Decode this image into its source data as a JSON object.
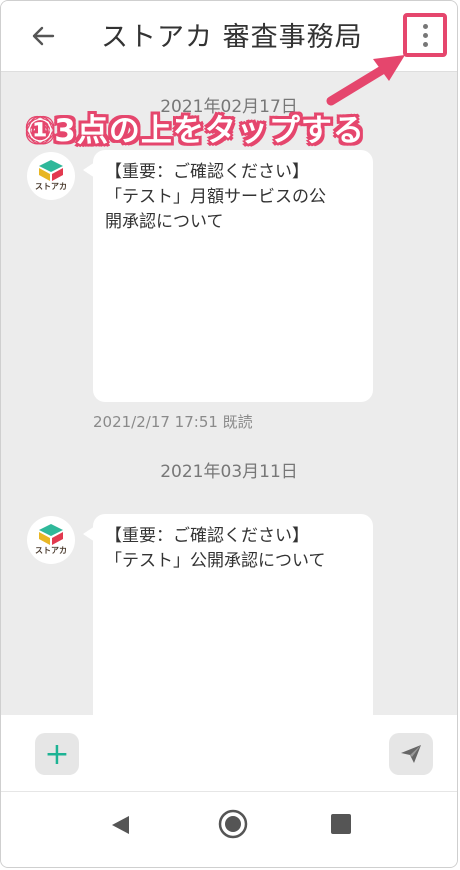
{
  "header": {
    "title": "ストアカ 審査事務局",
    "back_icon": "arrow-left-icon",
    "menu_icon": "more-vertical-icon"
  },
  "annotation": {
    "text": "①3点の上をタップする",
    "color": "#e5466d"
  },
  "messages": [
    {
      "date": "2021年02月17日",
      "sender_brand": "ストアカ",
      "lines": [
        "【重要：ご確認ください】",
        "「テスト」月額サービスの公",
        "開承認について"
      ],
      "meta": "2021/2/17 17:51  既読"
    },
    {
      "date": "2021年03月11日",
      "sender_brand": "ストアカ",
      "lines": [
        "【重要：ご確認ください】",
        "「テスト」公開承認について"
      ]
    }
  ],
  "inputbar": {
    "add_label": "+",
    "add_icon": "plus-icon",
    "send_icon": "send-icon",
    "accent": "#1db394"
  },
  "navbar": {
    "back_icon": "nav-back-icon",
    "home_icon": "nav-home-icon",
    "recent_icon": "nav-recent-icon"
  }
}
